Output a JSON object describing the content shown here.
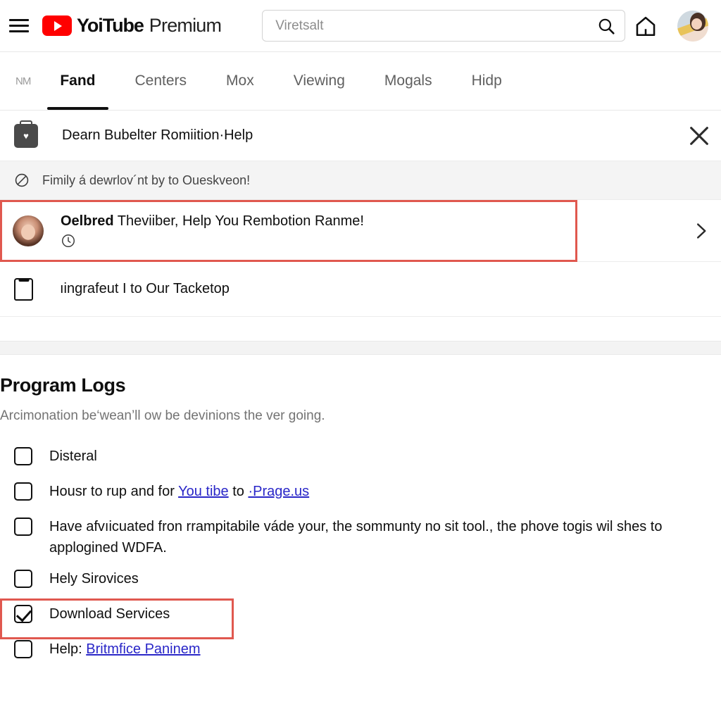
{
  "header": {
    "menu_icon": "hamburger-icon",
    "brand_name": "YoiTube",
    "brand_suffix": "Premium",
    "search": {
      "placeholder": "Viretsalt",
      "value": "",
      "icon": "search-icon"
    },
    "home_icon": "home-icon",
    "avatar": "user-avatar"
  },
  "tabs": [
    {
      "label": "ΝΜ",
      "active": false
    },
    {
      "label": "Fand",
      "active": true
    },
    {
      "label": "Centers",
      "active": false
    },
    {
      "label": "Mox",
      "active": false
    },
    {
      "label": "Viewing",
      "active": false
    },
    {
      "label": "Mogals",
      "active": false
    },
    {
      "label": "Hidp",
      "active": false
    }
  ],
  "banner": {
    "icon": "briefcase-heart-icon",
    "text": "Dearn Bubelter Romiition·Help",
    "close_icon": "close-icon"
  },
  "notice": {
    "icon": "prohibition-icon",
    "text": "Fimily á dewrlov´nt by to Oueskveon!"
  },
  "highlight_row": {
    "avatar": "person-avatar",
    "title_bold": "Oelbred",
    "title_rest": " Theviiber, Help You Rembotion  Ranme!",
    "meta_icon": "clock-icon",
    "chevron_icon": "chevron-right-icon",
    "highlight_color": "#e0584f"
  },
  "plain_row": {
    "icon": "bag-outline-icon",
    "text": "ıingrafeut I to Our Tacketop"
  },
  "program": {
    "title": "Program Logs",
    "subtitle": "Arcimonation be‘wean’ll ow be devinions the ver going.",
    "items": [
      {
        "checked": false,
        "label": "Disteral",
        "highlight": false
      },
      {
        "checked": false,
        "label_pre": "Housr to rup and for ",
        "link1": "You tibe",
        "label_mid": " to ",
        "link2": "·Prage.us",
        "highlight": false
      },
      {
        "checked": false,
        "label": "Have afvıicuated fron rrampitabile váde your, the sommunty no sit tool., the phove togis wil shes to applogined WDFA.",
        "highlight": false
      },
      {
        "checked": false,
        "label": "Hely Sirovices",
        "highlight": false
      },
      {
        "checked": true,
        "label": "Download Services",
        "highlight": true
      },
      {
        "checked": false,
        "label_pre": "Help: ",
        "link1": "Britmfice Paninem",
        "highlight": false
      }
    ]
  }
}
